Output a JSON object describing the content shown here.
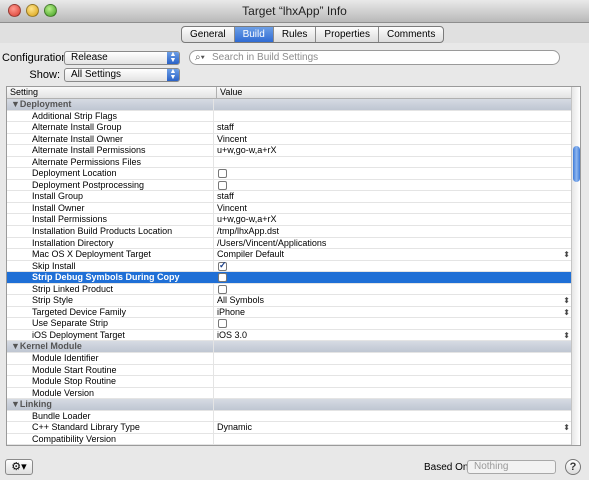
{
  "window": {
    "title": "Target “lhxApp” Info"
  },
  "tabs": [
    {
      "label": "General",
      "active": false
    },
    {
      "label": "Build",
      "active": true
    },
    {
      "label": "Rules",
      "active": false
    },
    {
      "label": "Properties",
      "active": false
    },
    {
      "label": "Comments",
      "active": false
    }
  ],
  "configuration": {
    "label": "Configuration:",
    "value": "Release"
  },
  "show": {
    "label": "Show:",
    "value": "All Settings"
  },
  "search": {
    "placeholder": "Search in Build Settings"
  },
  "table": {
    "col_setting": "Setting",
    "col_value": "Value",
    "rows": [
      {
        "type": "group",
        "setting": "▼Deployment"
      },
      {
        "setting": "Additional Strip Flags",
        "value": ""
      },
      {
        "setting": "Alternate Install Group",
        "value": "staff"
      },
      {
        "setting": "Alternate Install Owner",
        "value": "Vincent"
      },
      {
        "setting": "Alternate Install Permissions",
        "value": "u+w,go-w,a+rX"
      },
      {
        "setting": "Alternate Permissions Files",
        "value": ""
      },
      {
        "setting": "Deployment Location",
        "checkbox": false
      },
      {
        "setting": "Deployment Postprocessing",
        "checkbox": false
      },
      {
        "setting": "Install Group",
        "value": "staff"
      },
      {
        "setting": "Install Owner",
        "value": "Vincent"
      },
      {
        "setting": "Install Permissions",
        "value": "u+w,go-w,a+rX"
      },
      {
        "setting": "Installation Build Products Location",
        "value": "/tmp/lhxApp.dst"
      },
      {
        "setting": "Installation Directory",
        "value": "/Users/Vincent/Applications"
      },
      {
        "setting": "Mac OS X Deployment Target",
        "value": "Compiler Default",
        "popup": true
      },
      {
        "setting": "Skip Install",
        "checkbox": true
      },
      {
        "setting": "Strip Debug Symbols During Copy",
        "checkbox": false,
        "selected": true
      },
      {
        "setting": "Strip Linked Product",
        "checkbox": false
      },
      {
        "setting": "Strip Style",
        "value": "All Symbols",
        "popup": true
      },
      {
        "setting": "Targeted Device Family",
        "value": "iPhone",
        "popup": true
      },
      {
        "setting": "Use Separate Strip",
        "checkbox": false
      },
      {
        "setting": "iOS Deployment Target",
        "value": "iOS 3.0",
        "popup": true
      },
      {
        "type": "group",
        "setting": "▼Kernel Module"
      },
      {
        "setting": "Module Identifier",
        "value": ""
      },
      {
        "setting": "Module Start Routine",
        "value": ""
      },
      {
        "setting": "Module Stop Routine",
        "value": ""
      },
      {
        "setting": "Module Version",
        "value": ""
      },
      {
        "type": "group",
        "setting": "▼Linking"
      },
      {
        "setting": "Bundle Loader",
        "value": ""
      },
      {
        "setting": "C++ Standard Library Type",
        "value": "Dynamic",
        "popup": true
      },
      {
        "setting": "Compatibility Version",
        "value": ""
      }
    ]
  },
  "footer": {
    "gear_icon": "gear-icon",
    "based_on_label": "Based On:",
    "based_on_value": "Nothing",
    "help_label": "?"
  }
}
